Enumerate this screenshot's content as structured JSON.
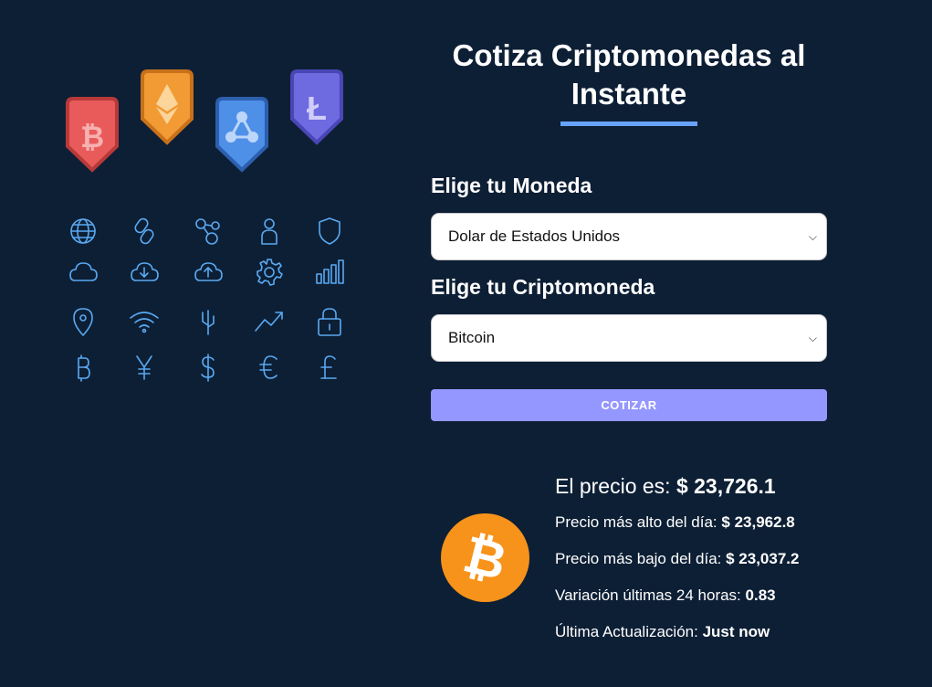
{
  "page": {
    "title": "Cotiza Criptomonedas al Instante"
  },
  "form": {
    "currency_label": "Elige tu Moneda",
    "currency_selected": "Dolar de Estados Unidos",
    "crypto_label": "Elige tu Criptomoneda",
    "crypto_selected": "Bitcoin",
    "submit_label": "COTIZAR"
  },
  "result": {
    "price_label": "El precio es:",
    "price_value": "$ 23,726.1",
    "high_label": "Precio más alto del día:",
    "high_value": "$ 23,962.8",
    "low_label": "Precio más bajo del día:",
    "low_value": "$ 23,037.2",
    "change_label": "Variación últimas 24 horas:",
    "change_value": "0.83",
    "updated_label": "Última Actualización:",
    "updated_value": "Just now"
  },
  "illustration": {
    "badges": [
      "bitcoin-icon",
      "ethereum-icon",
      "ripple-icon",
      "litecoin-icon"
    ],
    "icons": [
      "globe-icon",
      "link-icon",
      "network-icon",
      "user-icon",
      "shield-icon",
      "cloud-icon",
      "cloud-download-icon",
      "cloud-upload-icon",
      "gear-icon",
      "bar-chart-icon",
      "location-pin-icon",
      "wifi-icon",
      "usb-icon",
      "trend-up-icon",
      "padlock-icon",
      "bitcoin-symbol-icon",
      "yen-symbol-icon",
      "dollar-symbol-icon",
      "euro-symbol-icon",
      "pound-symbol-icon"
    ],
    "colors": {
      "background": "#0d1f35",
      "accent": "#66a2fe",
      "button": "#9497ff",
      "icon_stroke": "#5aa9f2",
      "bitcoin_orange": "#f7931a"
    }
  }
}
